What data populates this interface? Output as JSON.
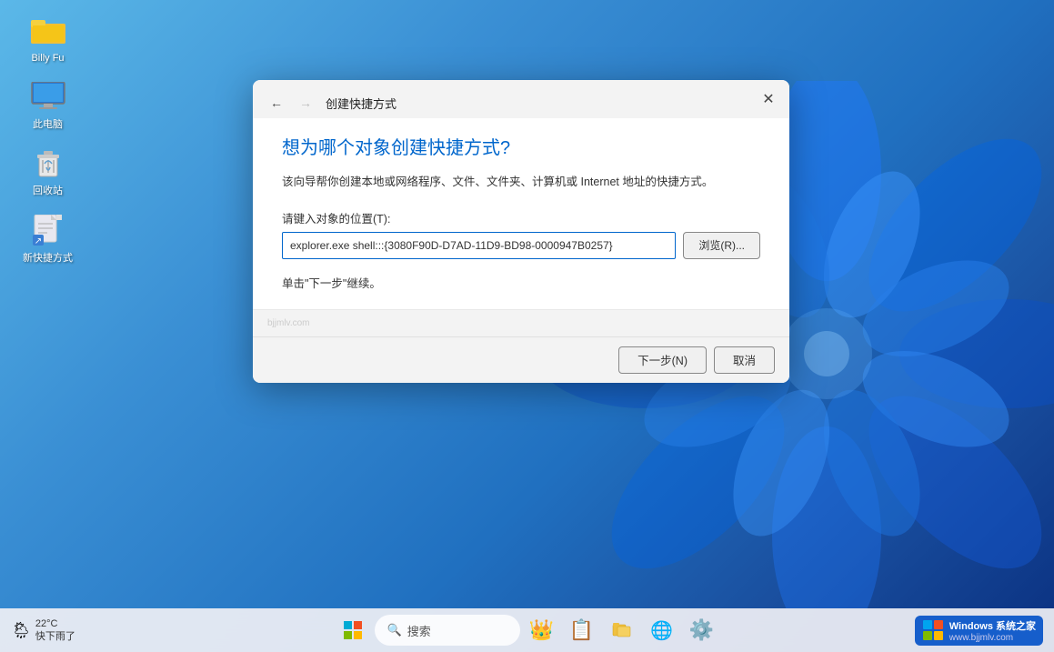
{
  "desktop": {
    "icons": [
      {
        "id": "billy-fu",
        "label": "Billy Fu",
        "type": "folder"
      },
      {
        "id": "this-pc",
        "label": "此电脑",
        "type": "monitor"
      },
      {
        "id": "recycle-bin",
        "label": "回收站",
        "type": "recycle"
      },
      {
        "id": "new-shortcut",
        "label": "新快捷方式",
        "type": "document"
      }
    ]
  },
  "dialog": {
    "title": "创建快捷方式",
    "heading": "想为哪个对象创建快捷方式?",
    "description": "该向导帮你创建本地或网络程序、文件、文件夹、计算机或 Internet 地址的快捷方式。",
    "field_label": "请键入对象的位置(T):",
    "input_value": "explorer.exe shell:::{3080F90D-D7AD-11D9-BD98-0000947B0257}",
    "browse_label": "浏览(R)...",
    "hint": "单击\"下一步\"继续。",
    "next_label": "下一步(N)",
    "cancel_label": "取消",
    "close_label": "×"
  },
  "taskbar": {
    "weather_temp": "22°C",
    "weather_condition": "快下雨了",
    "search_placeholder": "搜索",
    "windows_brand": "Windows 系统之家",
    "windows_url": "www.bjjmlv.com"
  }
}
